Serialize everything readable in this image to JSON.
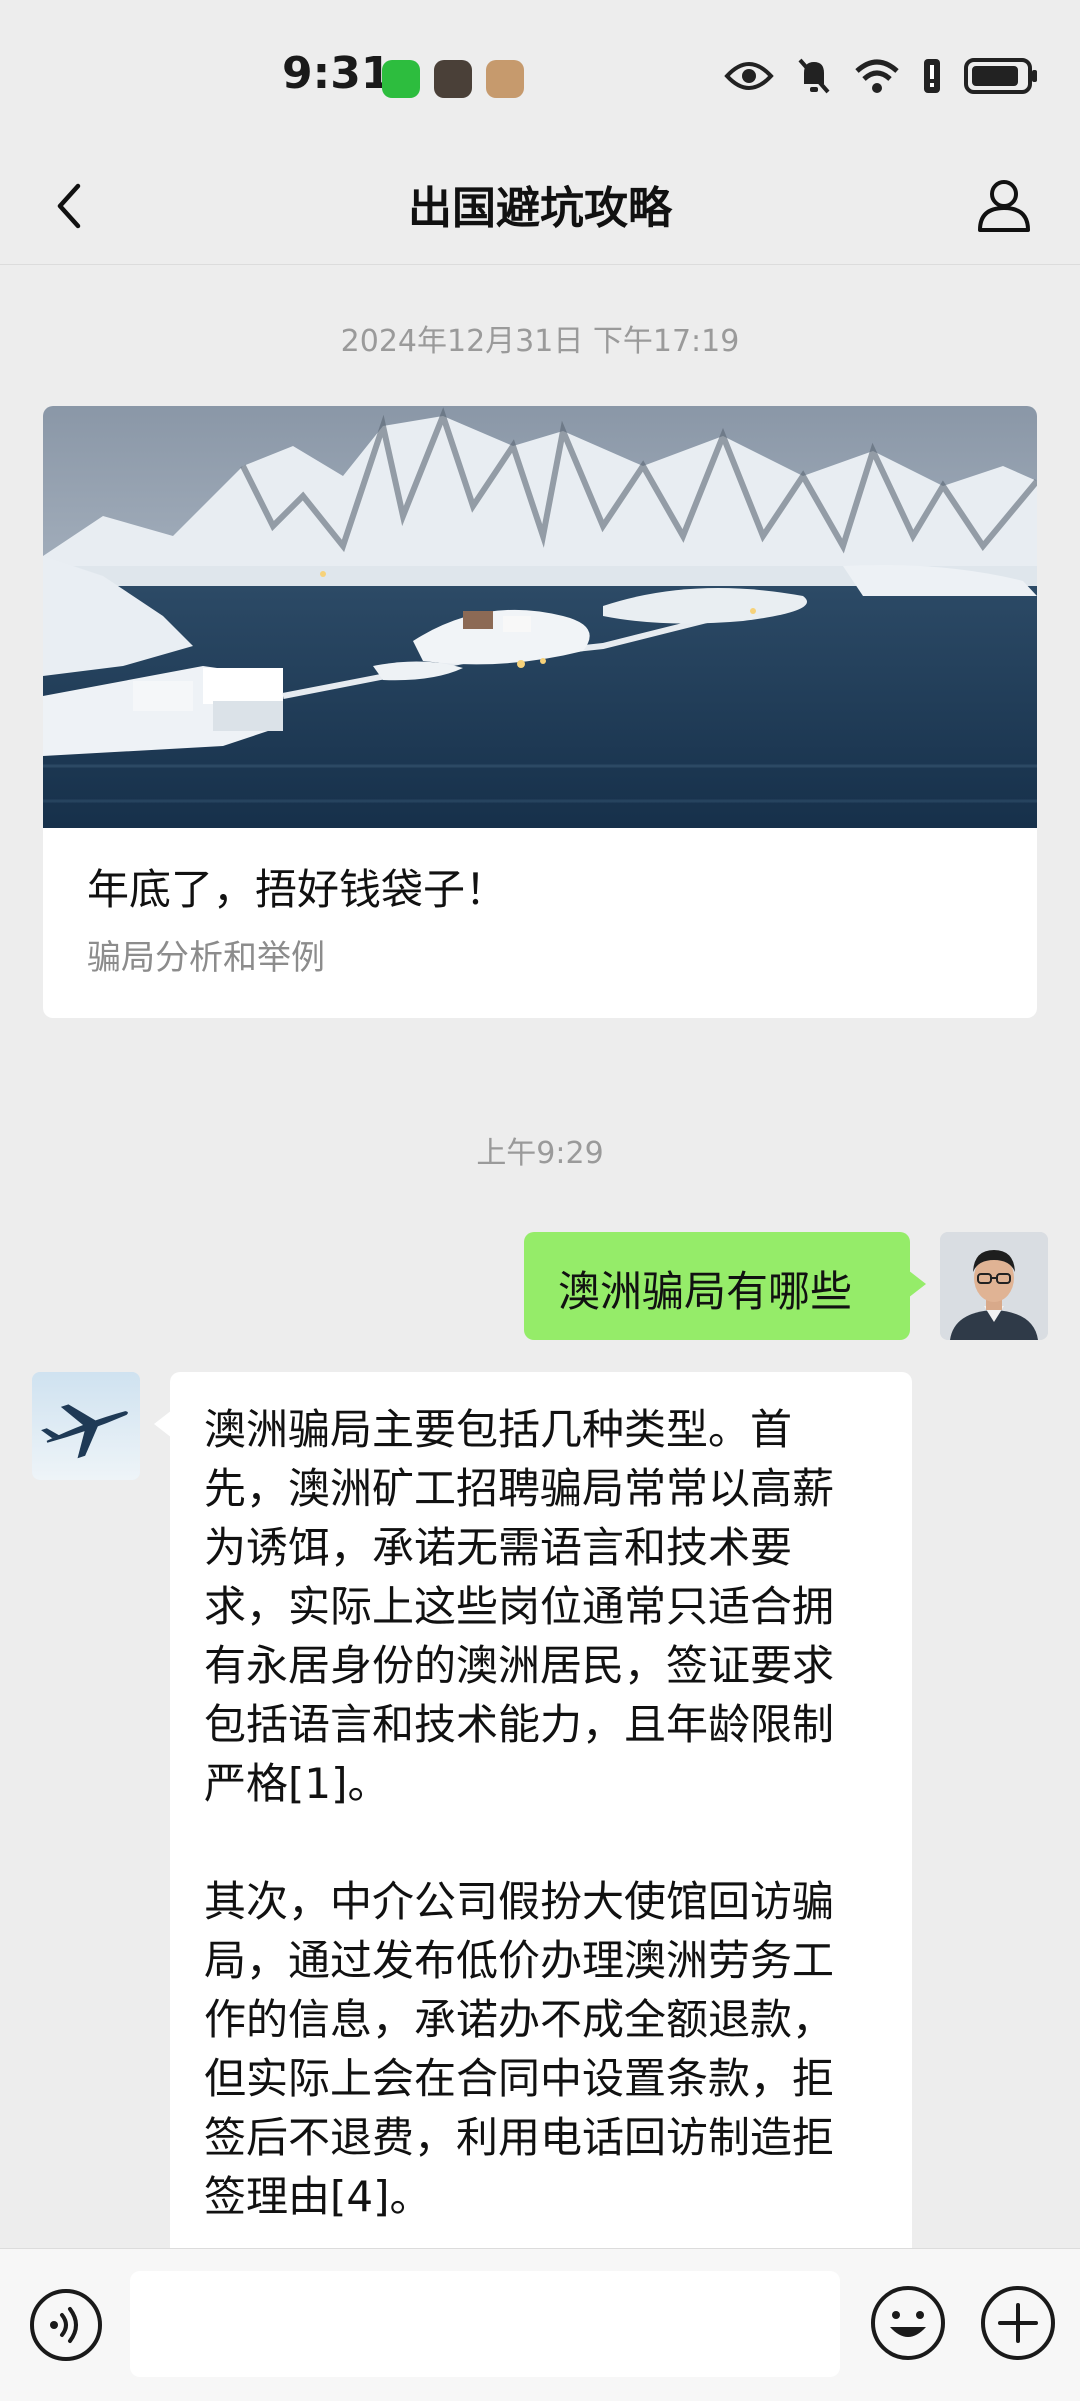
{
  "status_bar": {
    "time": "9:31"
  },
  "header": {
    "title": "出国避坑攻略"
  },
  "timestamps": {
    "article": "2024年12月31日 下午17:19",
    "chat": "上午9:29"
  },
  "article": {
    "title": "年底了，捂好钱袋子！",
    "subtitle": "骗局分析和举例"
  },
  "messages": {
    "user": "澳洲骗局有哪些",
    "bot_p1": "澳洲骗局主要包括几种类型。首\n先，澳洲矿工招聘骗局常常以高薪\n为诱饵，承诺无需语言和技术要\n求，实际上这些岗位通常只适合拥\n有永居身份的澳洲居民，签证要求\n包括语言和技术能力，且年龄限制\n严格[1]。",
    "bot_p2": "其次，中介公司假扮大使馆回访骗\n局，通过发布低价办理澳洲劳务工\n作的信息，承诺办不成全额退款，\n但实际上会在合同中设置条款，拒\n签后不退费，利用电话回访制造拒\n签理由[4]。"
  },
  "colors": {
    "user_bubble": "#95ec69",
    "background": "#ededed"
  }
}
